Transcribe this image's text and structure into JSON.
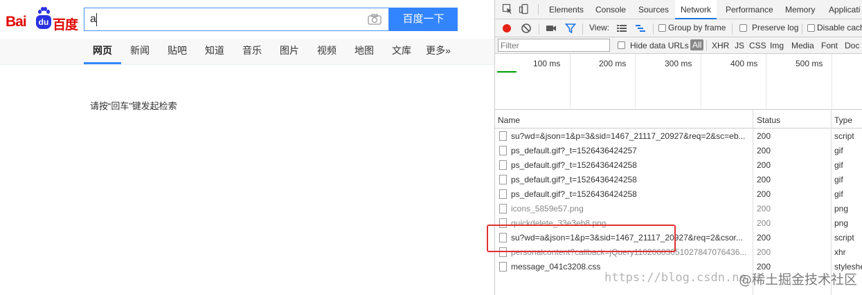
{
  "baidu": {
    "logo_text": "Bai",
    "logo_du": "du",
    "logo_cn": "百度",
    "search_value": "a",
    "search_button": "百度一下",
    "tabs": [
      {
        "label": "网页",
        "active": true
      },
      {
        "label": "新闻"
      },
      {
        "label": "贴吧"
      },
      {
        "label": "知道"
      },
      {
        "label": "音乐"
      },
      {
        "label": "图片"
      },
      {
        "label": "视频"
      },
      {
        "label": "地图"
      },
      {
        "label": "文库"
      },
      {
        "label": "更多»"
      }
    ],
    "hint": "请按“回车”键发起检索"
  },
  "devtools": {
    "panels": [
      "Elements",
      "Console",
      "Sources",
      "Network",
      "Performance",
      "Memory",
      "Applicati"
    ],
    "active_panel": "Network",
    "toolbar": {
      "view_label": "View:",
      "group_by_frame": "Group by frame",
      "preserve_log": "Preserve log",
      "disable_cache": "Disable cach"
    },
    "filter": {
      "placeholder": "Filter",
      "hide_data_urls": "Hide data URLs",
      "types": [
        "All",
        "XHR",
        "JS",
        "CSS",
        "Img",
        "Media",
        "Font",
        "Doc"
      ]
    },
    "timeline_ticks": [
      "100 ms",
      "200 ms",
      "300 ms",
      "400 ms",
      "500 ms"
    ],
    "columns": {
      "name": "Name",
      "status": "Status",
      "type": "Type"
    },
    "rows": [
      {
        "name": "su?wd=&json=1&p=3&sid=1467_21117_20927&req=2&sc=eb...",
        "status": "200",
        "type": "script"
      },
      {
        "name": "ps_default.gif?_t=1526436424257",
        "status": "200",
        "type": "gif"
      },
      {
        "name": "ps_default.gif?_t=1526436424258",
        "status": "200",
        "type": "gif"
      },
      {
        "name": "ps_default.gif?_t=1526436424258",
        "status": "200",
        "type": "gif"
      },
      {
        "name": "ps_default.gif?_t=1526436424258",
        "status": "200",
        "type": "gif"
      },
      {
        "name": "icons_5859e57.png",
        "status": "200",
        "type": "png"
      },
      {
        "name": "quickdelete_33e3eb8.png",
        "status": "200",
        "type": "png"
      },
      {
        "name": "su?wd=a&json=1&p=3&sid=1467_21117_20927&req=2&csor...",
        "status": "200",
        "type": "script"
      },
      {
        "name": "personalcontent?callback=jQuery11020603051027847076436...",
        "status": "200",
        "type": "xhr"
      },
      {
        "name": "message_041c3208.css",
        "status": "200",
        "type": "styleshe"
      }
    ]
  },
  "watermark": {
    "url": "https://blog.csdn.ne",
    "site": "@稀土掘金技术社区"
  },
  "colors": {
    "baidu_blue": "#3385ff",
    "baidu_red": "#e10602",
    "highlight_red": "#e03030",
    "record_red": "#e62117"
  }
}
